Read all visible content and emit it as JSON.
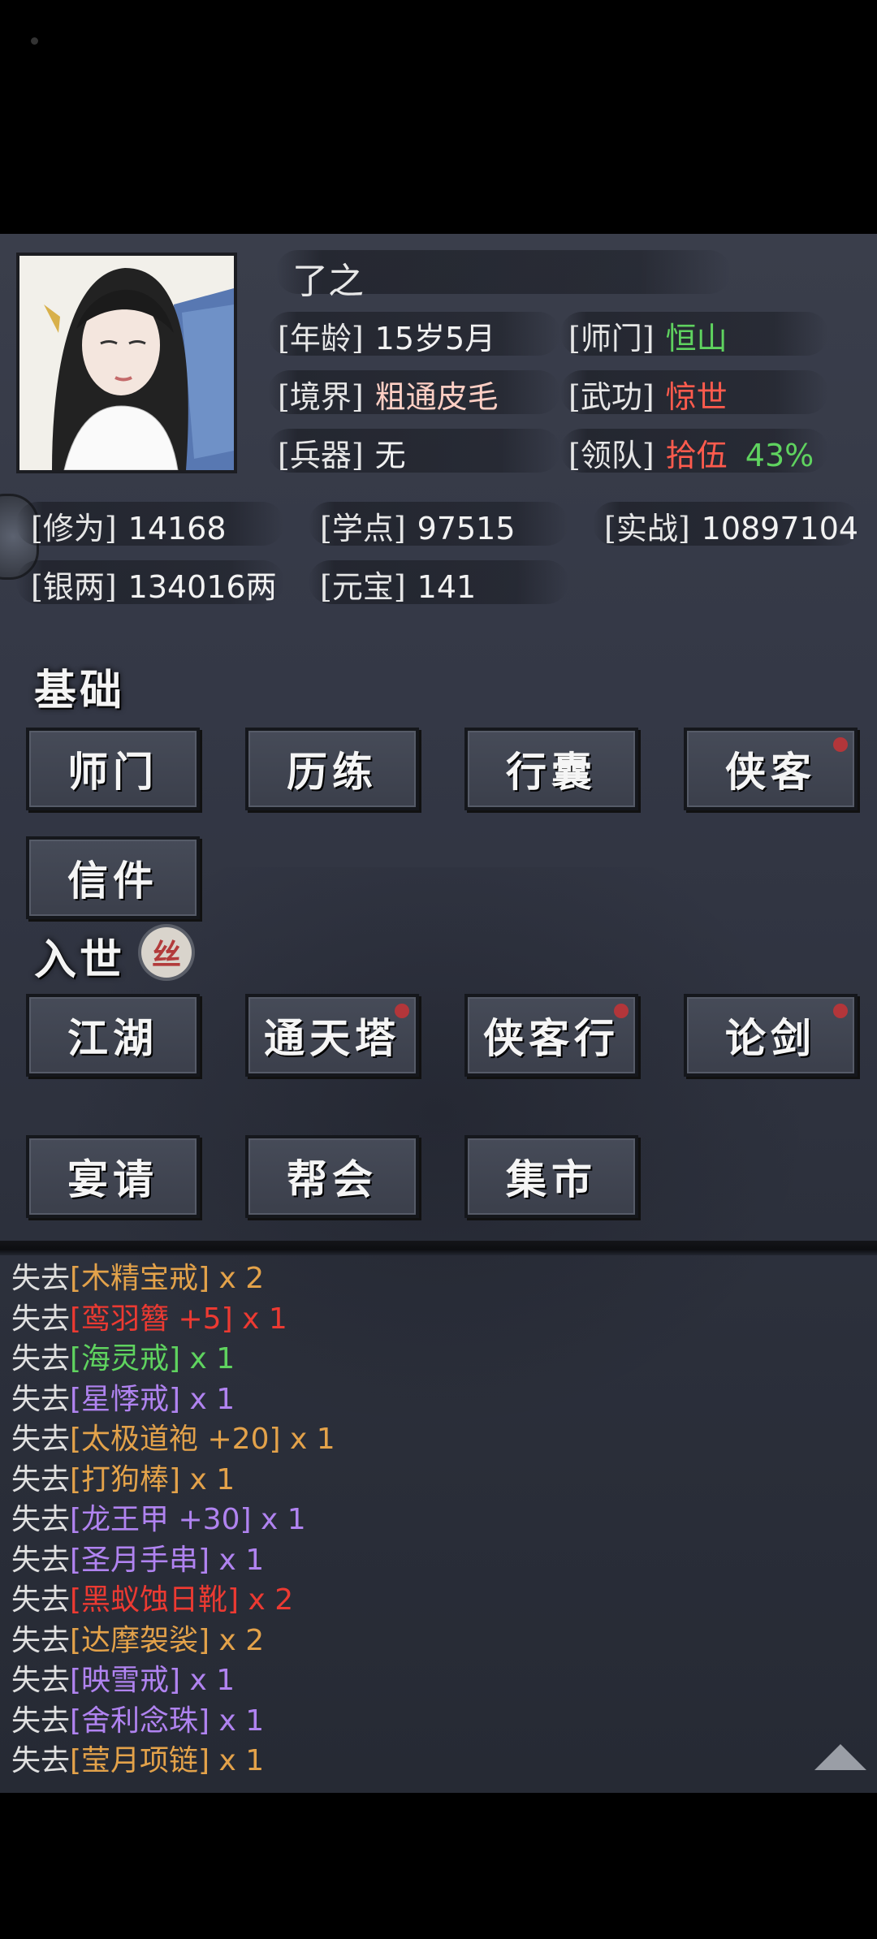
{
  "profile": {
    "name": "了之",
    "age": {
      "label": "[年龄]",
      "value": "15岁5月"
    },
    "sect": {
      "label": "[师门]",
      "value": "恒山"
    },
    "realm": {
      "label": "[境界]",
      "value": "粗通皮毛"
    },
    "martial": {
      "label": "[武功]",
      "value": "惊世"
    },
    "weapon": {
      "label": "[兵器]",
      "value": "无"
    },
    "team": {
      "label": "[领队]",
      "value": "拾伍",
      "percent": "43%"
    }
  },
  "stats": {
    "cultivation": {
      "label": "[修为]",
      "value": "14168"
    },
    "study": {
      "label": "[学点]",
      "value": "97515"
    },
    "combat": {
      "label": "[实战]",
      "value": "10897104"
    },
    "silver": {
      "label": "[银两]",
      "value": "134016两"
    },
    "ingot": {
      "label": "[元宝]",
      "value": "141"
    }
  },
  "basic": {
    "title": "基础",
    "buttons": [
      "师门",
      "历练",
      "行囊",
      "侠客",
      "信件"
    ]
  },
  "world": {
    "title": "入世",
    "seal": "丝",
    "buttons": [
      "江湖",
      "通天塔",
      "侠客行",
      "论剑",
      "宴请",
      "帮会",
      "集市"
    ]
  },
  "log": [
    {
      "pre": "失去",
      "item": "[木精宝戒]",
      "qty": " x 2",
      "color": "orange"
    },
    {
      "pre": "失去",
      "item": "[鸾羽簪 +5]",
      "qty": " x 1",
      "color": "itemred"
    },
    {
      "pre": "失去",
      "item": "[海灵戒]",
      "qty": " x 1",
      "color": "itemgreen"
    },
    {
      "pre": "失去",
      "item": "[星悸戒]",
      "qty": " x 1",
      "color": "purple"
    },
    {
      "pre": "失去",
      "item": "[太极道袍 +20]",
      "qty": " x 1",
      "color": "orange"
    },
    {
      "pre": "失去",
      "item": "[打狗棒]",
      "qty": " x 1",
      "color": "orange"
    },
    {
      "pre": "失去",
      "item": "[龙王甲 +30]",
      "qty": " x 1",
      "color": "purple"
    },
    {
      "pre": "失去",
      "item": "[圣月手串]",
      "qty": " x 1",
      "color": "purple"
    },
    {
      "pre": "失去",
      "item": "[黑蚁蚀日靴]",
      "qty": " x 2",
      "color": "itemred"
    },
    {
      "pre": "失去",
      "item": "[达摩袈裟]",
      "qty": " x 2",
      "color": "orange"
    },
    {
      "pre": "失去",
      "item": "[映雪戒]",
      "qty": " x 1",
      "color": "purple"
    },
    {
      "pre": "失去",
      "item": "[舍利念珠]",
      "qty": " x 1",
      "color": "purple"
    },
    {
      "pre": "失去",
      "item": "[莹月项链]",
      "qty": " x 1",
      "color": "orange"
    }
  ]
}
